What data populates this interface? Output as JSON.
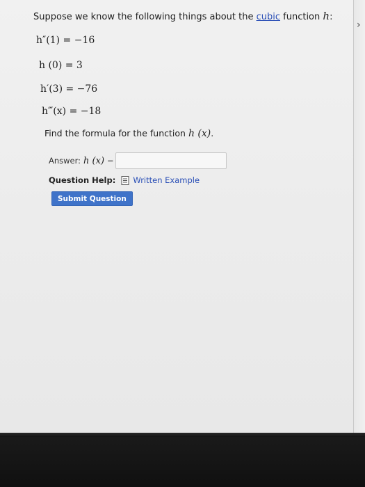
{
  "question": {
    "intro_prefix": "Suppose we know the following things about the ",
    "intro_link": "cubic",
    "intro_suffix": " function ",
    "intro_var": "h",
    "intro_end": ":",
    "conditions": [
      "h″(1) = −16",
      "h (0) = 3",
      "h′(3) = −76",
      "h‴(x) = −18"
    ],
    "find_prefix": "Find the formula for the function ",
    "find_fn": "h (x)",
    "find_end": ".",
    "answer_label": "Answer:",
    "answer_fn": "h (x)",
    "answer_eq": "=",
    "answer_value": "",
    "help_label": "Question Help:",
    "help_link": "Written Example",
    "submit_label": "Submit Question"
  },
  "icons": {
    "help": "document-icon",
    "edge": "chevron-right-icon"
  },
  "colors": {
    "link": "#2a4fb6",
    "button": "#3f73c9"
  }
}
